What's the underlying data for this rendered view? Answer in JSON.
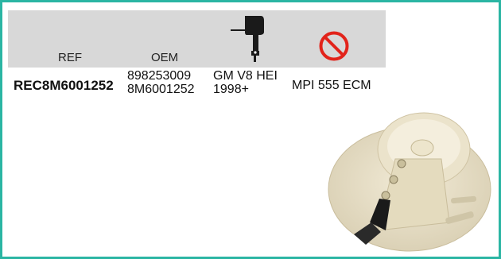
{
  "header": {
    "ref_label": "REF",
    "oem_label": "OEM",
    "engine_icon": "outboard-motor-icon",
    "exclusion_icon": "prohibited-icon"
  },
  "row": {
    "ref": "REC8M6001252",
    "oem_line1": "898253009",
    "oem_line2": "8M6001252",
    "engine_line1": "GM V8 HEI",
    "engine_line2": "1998+",
    "exclusion": "MPI 555 ECM"
  },
  "image": {
    "subject": "distributor-rotor-photo"
  },
  "colors": {
    "frame": "#2bb5a3",
    "header_band": "#d8d8d8",
    "prohibited_red": "#e2231a",
    "motor": "#1a1a1a"
  }
}
